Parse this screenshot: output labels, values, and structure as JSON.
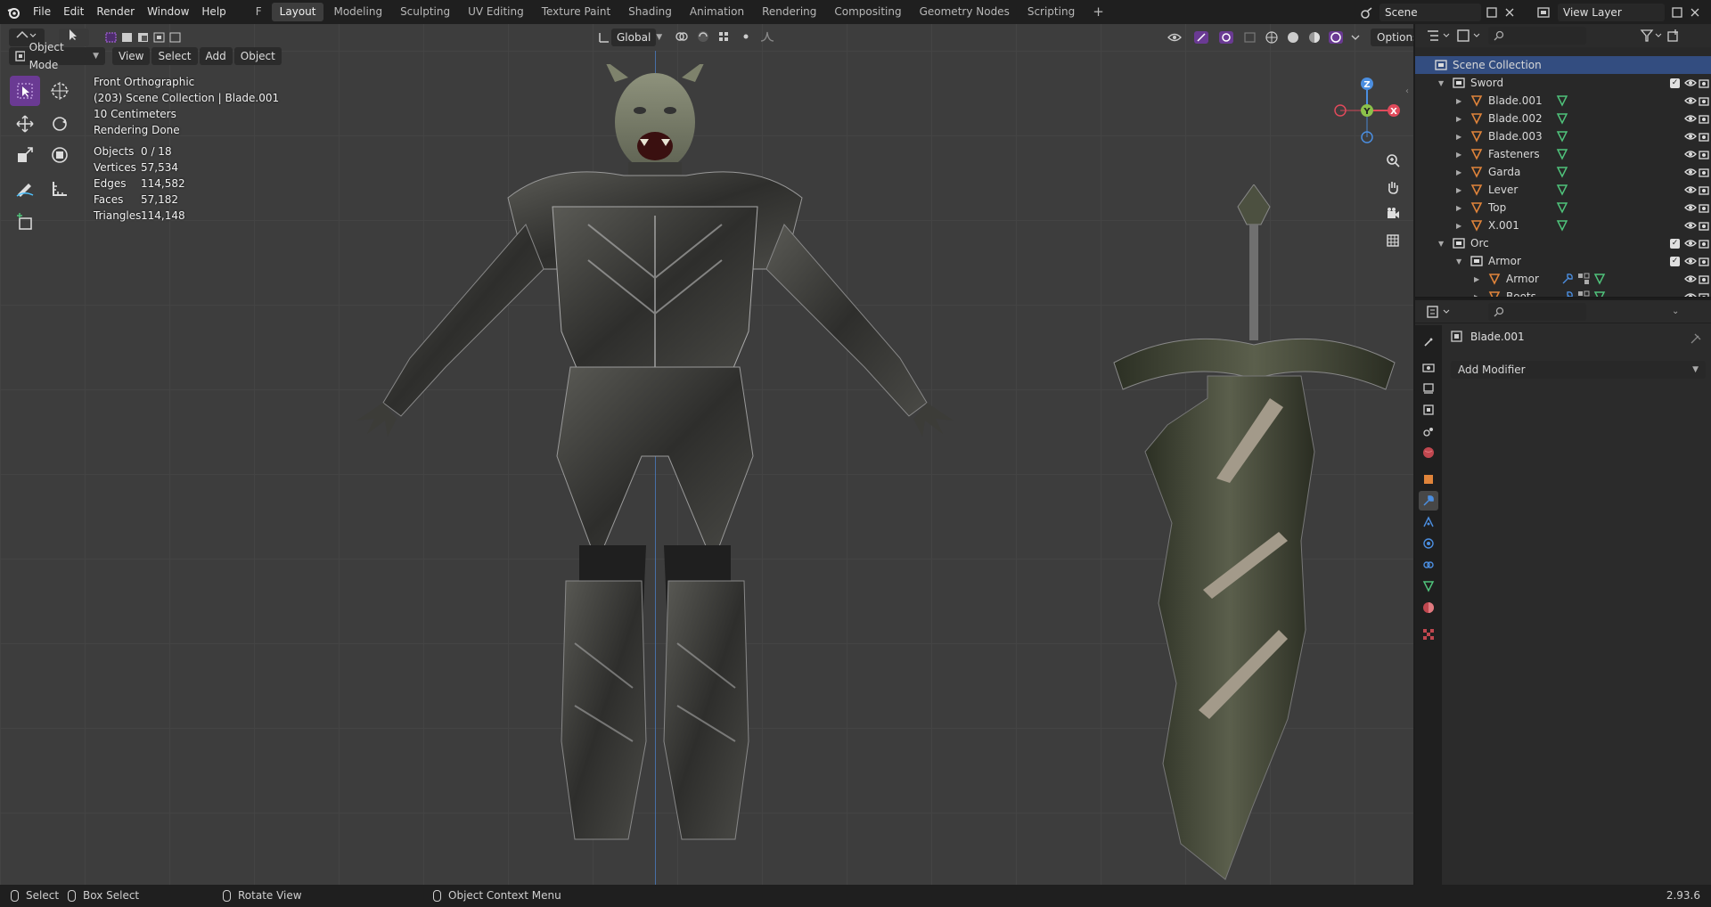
{
  "topbar": {
    "menus": [
      "File",
      "Edit",
      "Render",
      "Window",
      "Help"
    ],
    "workspace_tabs": [
      "F",
      "Layout",
      "Modeling",
      "Sculpting",
      "UV Editing",
      "Texture Paint",
      "Shading",
      "Animation",
      "Rendering",
      "Compositing",
      "Geometry Nodes",
      "Scripting"
    ],
    "active_tab": "Layout",
    "scene": "Scene",
    "view_layer": "View Layer"
  },
  "viewport_header": {
    "mode": "Object Mode",
    "menus": [
      "View",
      "Select",
      "Add",
      "Object"
    ],
    "transform_orientation": "Global",
    "options": "Options"
  },
  "viewport_info": {
    "view_name": "Front Orthographic",
    "collection_line": "(203) Scene Collection | Blade.001",
    "scale": "10 Centimeters",
    "render_status": "Rendering Done",
    "stats": [
      {
        "label": "Objects",
        "value": "0 / 18"
      },
      {
        "label": "Vertices",
        "value": "57,534"
      },
      {
        "label": "Edges",
        "value": "114,582"
      },
      {
        "label": "Faces",
        "value": "57,182"
      },
      {
        "label": "Triangles",
        "value": "114,148"
      }
    ]
  },
  "gizmo": {
    "z": "Z",
    "y": "Y",
    "x": "X"
  },
  "outliner": {
    "rows": [
      {
        "label": "Scene Collection",
        "level": 0,
        "kind": "scene",
        "selected": true
      },
      {
        "label": "Sword",
        "level": 1,
        "kind": "collection"
      },
      {
        "label": "Blade.001",
        "level": 2,
        "kind": "object"
      },
      {
        "label": "Blade.002",
        "level": 2,
        "kind": "object"
      },
      {
        "label": "Blade.003",
        "level": 2,
        "kind": "object"
      },
      {
        "label": "Fasteners",
        "level": 2,
        "kind": "object"
      },
      {
        "label": "Garda",
        "level": 2,
        "kind": "object"
      },
      {
        "label": "Lever",
        "level": 2,
        "kind": "object"
      },
      {
        "label": "Top",
        "level": 2,
        "kind": "object"
      },
      {
        "label": "X.001",
        "level": 2,
        "kind": "object"
      },
      {
        "label": "Orc",
        "level": 1,
        "kind": "collection"
      },
      {
        "label": "Armor",
        "level": 2,
        "kind": "collection"
      },
      {
        "label": "Armor",
        "level": 3,
        "kind": "object-mod"
      },
      {
        "label": "Boots",
        "level": 3,
        "kind": "object-mod"
      }
    ]
  },
  "properties": {
    "object_name": "Blade.001",
    "add_modifier": "Add Modifier"
  },
  "statusbar": {
    "select": "Select",
    "box_select": "Box Select",
    "rotate_view": "Rotate View",
    "context_menu": "Object Context Menu",
    "version": "2.93.6"
  },
  "colors": {
    "accent_purple": "#6a3a93",
    "selection_blue": "#334d80",
    "object_orange": "#e0843a",
    "mesh_green": "#4fc37b",
    "axis_x": "#e04a5b",
    "axis_y": "#8cc14a",
    "axis_z": "#4b8ee0"
  }
}
